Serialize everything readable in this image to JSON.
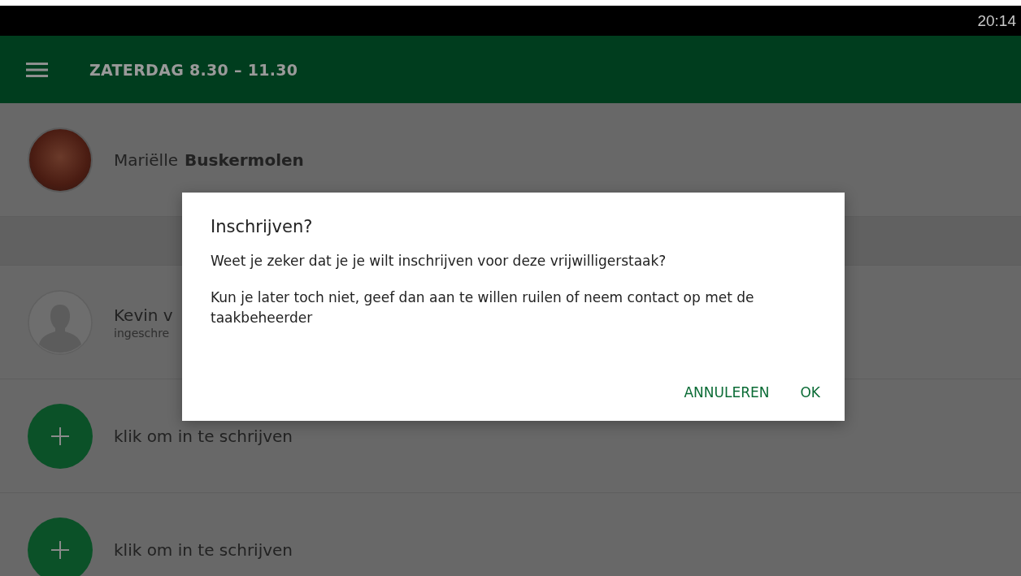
{
  "status_bar": {
    "time": "20:14"
  },
  "app_bar": {
    "title": "ZATERDAG 8.30 – 11.30"
  },
  "rows": [
    {
      "kind": "member",
      "avatar": {
        "kind": "photo"
      },
      "first_name": "Mariëlle",
      "last_name": "Buskermolen"
    },
    {
      "kind": "section"
    },
    {
      "kind": "member",
      "avatar": {
        "kind": "silhouette"
      },
      "first_name": "Kevin v",
      "subtitle": "ingeschre"
    },
    {
      "kind": "add",
      "text": "klik om in te schrijven"
    },
    {
      "kind": "add",
      "text": "klik om in te schrijven"
    }
  ],
  "dialog": {
    "title": "Inschrijven?",
    "paragraphs": [
      "Weet je zeker dat je je wilt inschrijven voor deze vrijwilligerstaak?",
      "Kun je later toch niet, geef dan aan te willen ruilen of neem contact op met de taakbeheerder"
    ],
    "buttons": [
      "ANNULEREN",
      "OK"
    ]
  }
}
